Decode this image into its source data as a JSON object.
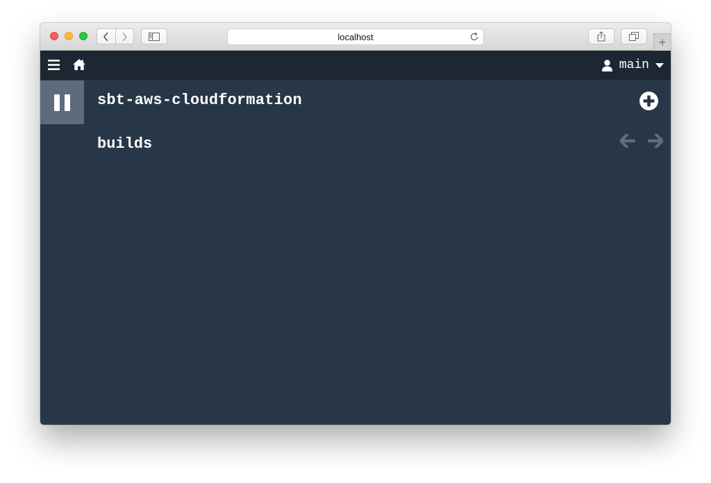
{
  "browser": {
    "url": "localhost",
    "new_tab_symbol": "+"
  },
  "appbar": {
    "username": "main"
  },
  "pipeline": {
    "name": "sbt-aws-cloudformation",
    "section": "builds"
  },
  "colors": {
    "page_background": "#283747",
    "top_bar": "#1d2733",
    "pause_block": "#5c6c7c",
    "text": "#ffffff",
    "disabled_arrow": "#5e6e7e"
  },
  "icons": [
    "hamburger-icon",
    "home-icon",
    "user-icon",
    "caret-down-icon",
    "pause-icon",
    "add-circle-icon",
    "arrow-left-icon",
    "arrow-right-icon"
  ]
}
